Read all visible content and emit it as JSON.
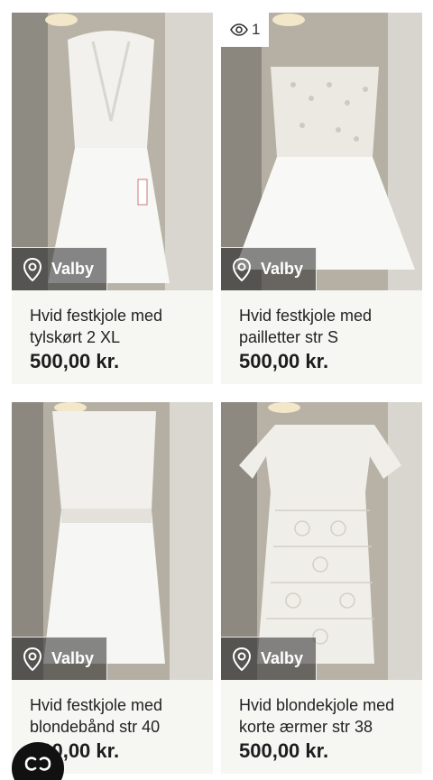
{
  "listings": [
    {
      "location": "Valby",
      "title": "Hvid festkjole med tylskørt 2 XL",
      "price": "500,00 kr."
    },
    {
      "location": "Valby",
      "title": "Hvid festkjole med pailletter str S",
      "price": "500,00 kr.",
      "views": "1"
    },
    {
      "location": "Valby",
      "title": "Hvid festkjole med blondebånd str 40",
      "price": "500,00 kr."
    },
    {
      "location": "Valby",
      "title": "Hvid blondekjole med korte ærmer str 38",
      "price": "500,00 kr."
    }
  ],
  "icons": {
    "location": "map-pin-icon",
    "views": "eye-icon",
    "fab": "chat-icon"
  },
  "colors": {
    "card_bg": "#f6f7f3",
    "price": "#1d1d1d",
    "fab": "#111111"
  }
}
